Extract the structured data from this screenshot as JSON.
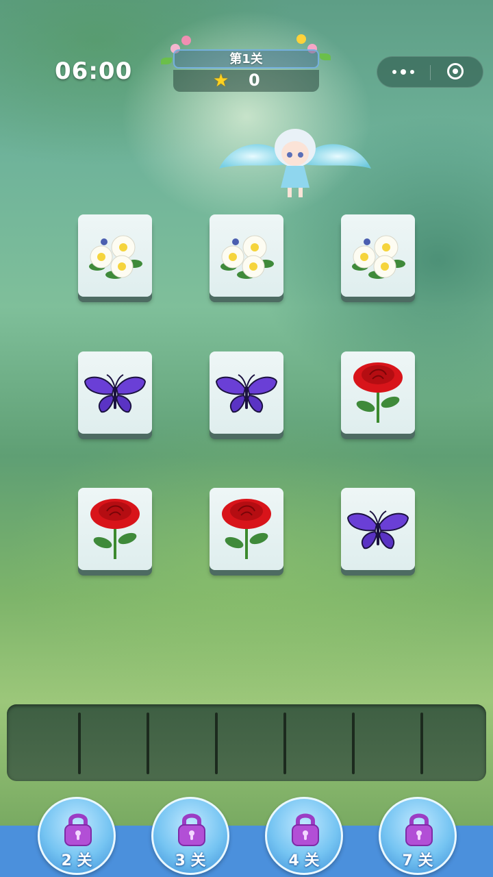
{
  "header": {
    "timer": "06:00",
    "level_title": "第1关",
    "score": "0"
  },
  "capsule": {
    "more_icon": "more-dots-icon",
    "close_icon": "target-close-icon"
  },
  "board": {
    "rows": [
      [
        "daisy",
        "daisy",
        "daisy"
      ],
      [
        "butterfly",
        "butterfly",
        "rose"
      ],
      [
        "rose",
        "rose",
        "butterfly"
      ]
    ]
  },
  "tray": {
    "slots": 7
  },
  "unlock_buttons": [
    {
      "label": "2 关",
      "icon": "lock-icon"
    },
    {
      "label": "3 关",
      "icon": "lock-icon"
    },
    {
      "label": "4 关",
      "icon": "lock-icon"
    },
    {
      "label": "7 关",
      "icon": "lock-icon"
    }
  ],
  "colors": {
    "accent_blue": "#4b90dc",
    "lock_purple": "#b24fd6",
    "star": "#ffd21f"
  }
}
